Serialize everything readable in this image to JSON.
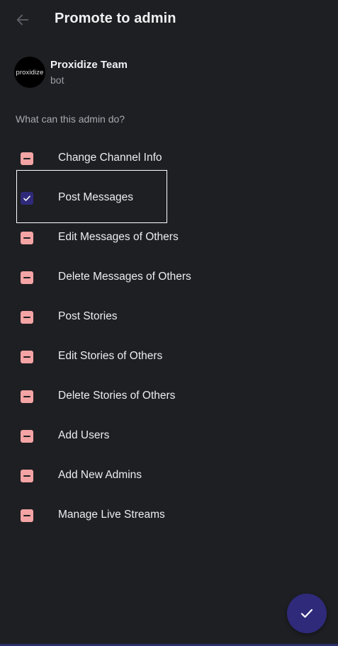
{
  "header": {
    "title": "Promote to admin",
    "back_icon": "arrow-left-icon"
  },
  "profile": {
    "avatar_text": "proxidize",
    "name": "Proxidize Team",
    "subtitle": "bot"
  },
  "section_label": "What can this admin do?",
  "permissions": [
    {
      "label": "Change Channel Info",
      "state": "unchecked"
    },
    {
      "label": "Post Messages",
      "state": "checked"
    },
    {
      "label": "Edit Messages of Others",
      "state": "unchecked"
    },
    {
      "label": "Delete Messages of Others",
      "state": "unchecked"
    },
    {
      "label": "Post Stories",
      "state": "unchecked"
    },
    {
      "label": "Edit Stories of Others",
      "state": "unchecked"
    },
    {
      "label": "Delete Stories of Others",
      "state": "unchecked"
    },
    {
      "label": "Add Users",
      "state": "unchecked"
    },
    {
      "label": "Add New Admins",
      "state": "unchecked"
    },
    {
      "label": "Manage Live Streams",
      "state": "unchecked"
    }
  ],
  "fab": {
    "icon": "check-icon"
  },
  "colors": {
    "background": "#1e1f23",
    "accent": "#2f2a7a",
    "unchecked_box": "#f4a4a4",
    "text": "#ededf0",
    "muted": "#a9a9b0"
  }
}
